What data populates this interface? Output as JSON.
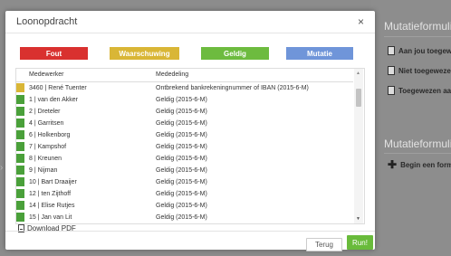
{
  "background": {
    "section1_title": "Mutatieformulie",
    "items1": [
      {
        "label": "Aan jou toegew"
      },
      {
        "label": "Niet toegewezen"
      },
      {
        "label": "Toegewezen aa"
      }
    ],
    "section2_title": "Mutatieformulie",
    "items2": [
      {
        "label": "Begin een formu"
      }
    ]
  },
  "modal": {
    "title": "Loonopdracht",
    "close_glyph": "×",
    "legend": [
      {
        "label": "Fout",
        "color": "#d9312f"
      },
      {
        "label": "Waarschuwing",
        "color": "#d9b636"
      },
      {
        "label": "Geldig",
        "color": "#6dbb3f"
      },
      {
        "label": "Mutatie",
        "color": "#6f95d9"
      }
    ],
    "table": {
      "headers": {
        "employee": "Medewerker",
        "message": "Mededeling"
      },
      "rows": [
        {
          "name": "3460 | René Tuenter",
          "message": "Ontbrekend bankrekeningnummer of IBAN (2015-6-M)",
          "color": "#d9b636"
        },
        {
          "name": "1 | van den Akker",
          "message": "Geldig (2015-6-M)",
          "color": "#4aa03a"
        },
        {
          "name": "2 | Dreteler",
          "message": "Geldig (2015-6-M)",
          "color": "#4aa03a"
        },
        {
          "name": "4 | Garritsen",
          "message": "Geldig (2015-6-M)",
          "color": "#4aa03a"
        },
        {
          "name": "6 | Holkenborg",
          "message": "Geldig (2015-6-M)",
          "color": "#4aa03a"
        },
        {
          "name": "7 | Kampshof",
          "message": "Geldig (2015-6-M)",
          "color": "#4aa03a"
        },
        {
          "name": "8 | Kreunen",
          "message": "Geldig (2015-6-M)",
          "color": "#4aa03a"
        },
        {
          "name": "9 | Nijman",
          "message": "Geldig (2015-6-M)",
          "color": "#4aa03a"
        },
        {
          "name": "10 | Bart Draaijer",
          "message": "Geldig (2015-6-M)",
          "color": "#4aa03a"
        },
        {
          "name": "12 | ten Zijthoff",
          "message": "Geldig (2015-6-M)",
          "color": "#4aa03a"
        },
        {
          "name": "14 | Elise Rutjes",
          "message": "Geldig (2015-6-M)",
          "color": "#4aa03a"
        },
        {
          "name": "15 | Jan van Lit",
          "message": "Geldig (2015-6-M)",
          "color": "#4aa03a"
        }
      ]
    },
    "download_label": "Download PDF",
    "buttons": {
      "back": "Terug",
      "run": "Run!"
    }
  }
}
